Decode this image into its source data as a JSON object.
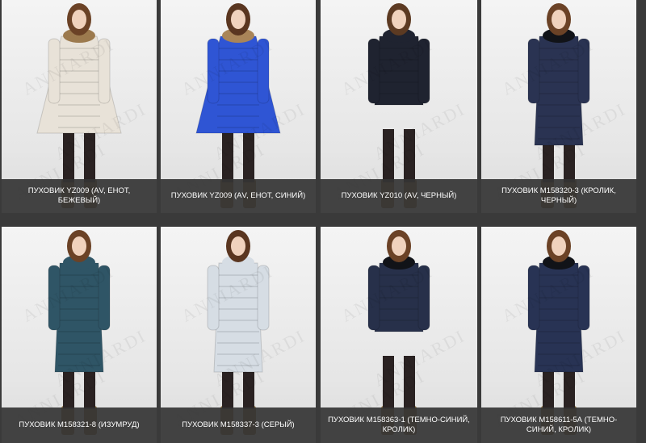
{
  "watermark": "ANNIARDI",
  "products": [
    {
      "title": "ПУХОВИК YZ009 (АV, ЕНОТ, БЕЖЕВЫЙ)",
      "coat_color": "#e8e2d8",
      "fur_color": "#9c7a4e",
      "hair_color": "#6b4226"
    },
    {
      "title": "ПУХОВИК YZ009 (АV, ЕНОТ, СИНИЙ)",
      "coat_color": "#2f55d4",
      "fur_color": "#a98558",
      "hair_color": "#5a3620"
    },
    {
      "title": "ПУХОВИК YZ010 (АV, ЧЕРНЫЙ)",
      "coat_color": "#1f2330",
      "fur_color": "#1f2330",
      "hair_color": "#5c3a22"
    },
    {
      "title": "ПУХОВИК M158320-3 (КРОЛИК, ЧЕРНЫЙ)",
      "coat_color": "#2a3352",
      "fur_color": "#111318",
      "hair_color": "#6b4226"
    },
    {
      "title": "ПУХОВИК M158321-8 (ИЗУМРУД)",
      "coat_color": "#2f5566",
      "fur_color": "#2f5566",
      "hair_color": "#6b4226"
    },
    {
      "title": "ПУХОВИК M158337-3 (СЕРЫЙ)",
      "coat_color": "#d6dde4",
      "fur_color": "#d6dde4",
      "hair_color": "#5a3620"
    },
    {
      "title": "ПУХОВИК M158363-1 (ТЕМНО-СИНИЙ, КРОЛИК)",
      "coat_color": "#27304a",
      "fur_color": "#111318",
      "hair_color": "#6b4226"
    },
    {
      "title": "ПУХОВИК M158611-5А (ТЕМНО-СИНИЙ, КРОЛИК)",
      "coat_color": "#283354",
      "fur_color": "#111318",
      "hair_color": "#6b4226"
    }
  ]
}
